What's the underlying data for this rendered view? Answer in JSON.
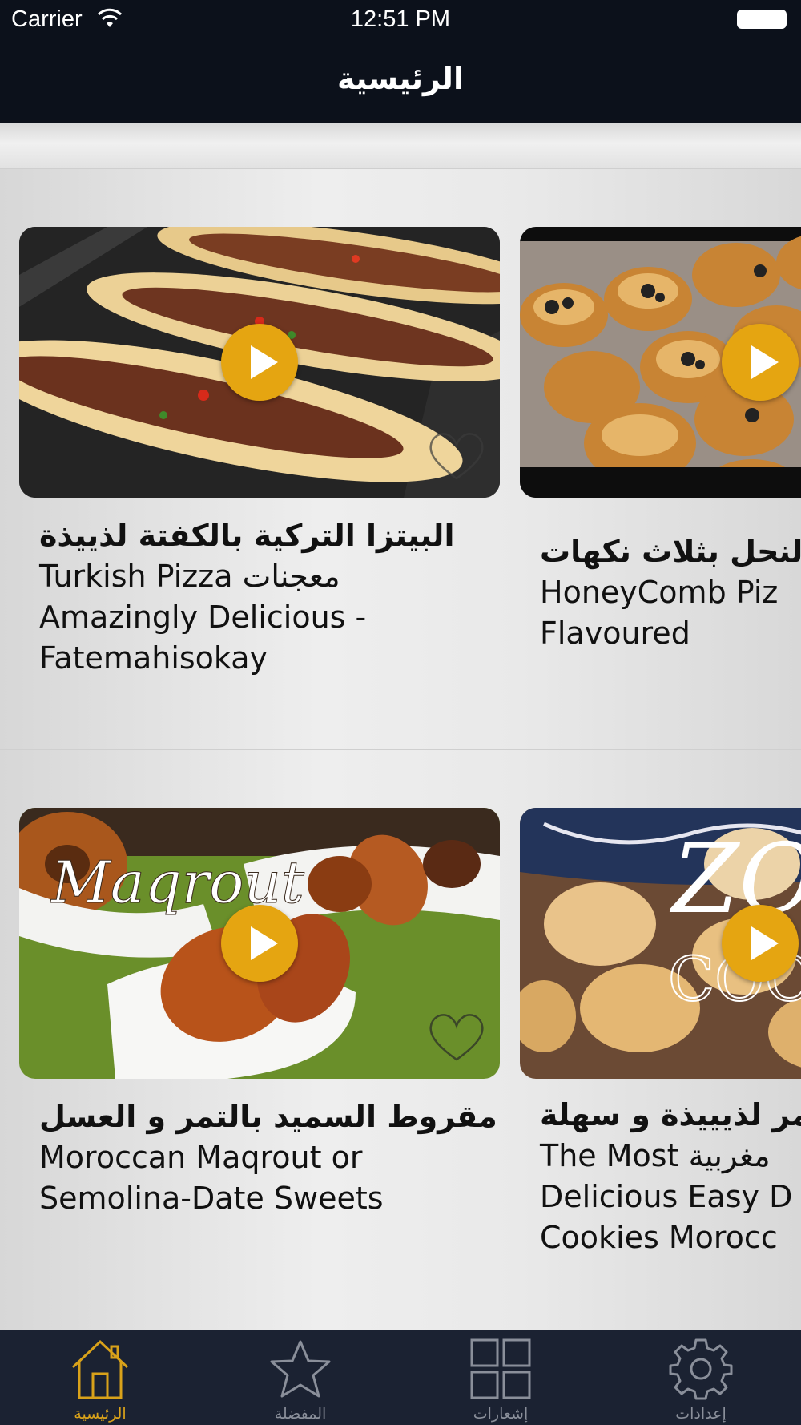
{
  "status_bar": {
    "carrier": "Carrier",
    "time": "12:51 PM"
  },
  "nav": {
    "title": "الرئيسية"
  },
  "rows": [
    {
      "left_card": {
        "title_ar": "البيتزا التركية بالكفتة لذييذة",
        "title_en": "Turkish Pizza معجنات\nAmazingly Delicious -\nFatemahisokay"
      },
      "right_card": {
        "title_ar": "النحل بثلاث نكهات",
        "title_en": "HoneyComb Piz\nFlavoured"
      }
    },
    {
      "left_card": {
        "thumb_text": "Maqrout",
        "title_ar": "مقروط السميد بالتمر و العسل",
        "title_en": "Moroccan Maqrout or\nSemolina-Date Sweets"
      },
      "right_card": {
        "thumb_text_1": "ZO",
        "thumb_text_2": "COO",
        "title_ar": "مر لذيييذة و سهلة",
        "title_en": "The Most مغربية\nDelicious Easy D\nCookies Morocc"
      }
    }
  ],
  "tab_bar": {
    "tabs": [
      {
        "label": "الرئيسية",
        "icon": "home-icon",
        "active": true
      },
      {
        "label": "المفضلة",
        "icon": "star-icon",
        "active": false
      },
      {
        "label": "إشعارات",
        "icon": "grid-icon",
        "active": false
      },
      {
        "label": "إعدادات",
        "icon": "gear-icon",
        "active": false
      }
    ]
  },
  "colors": {
    "bar_background": "#0c111b",
    "tab_background": "#1b2232",
    "accent": "#e5a511",
    "tab_inactive": "#8a8f9a"
  }
}
